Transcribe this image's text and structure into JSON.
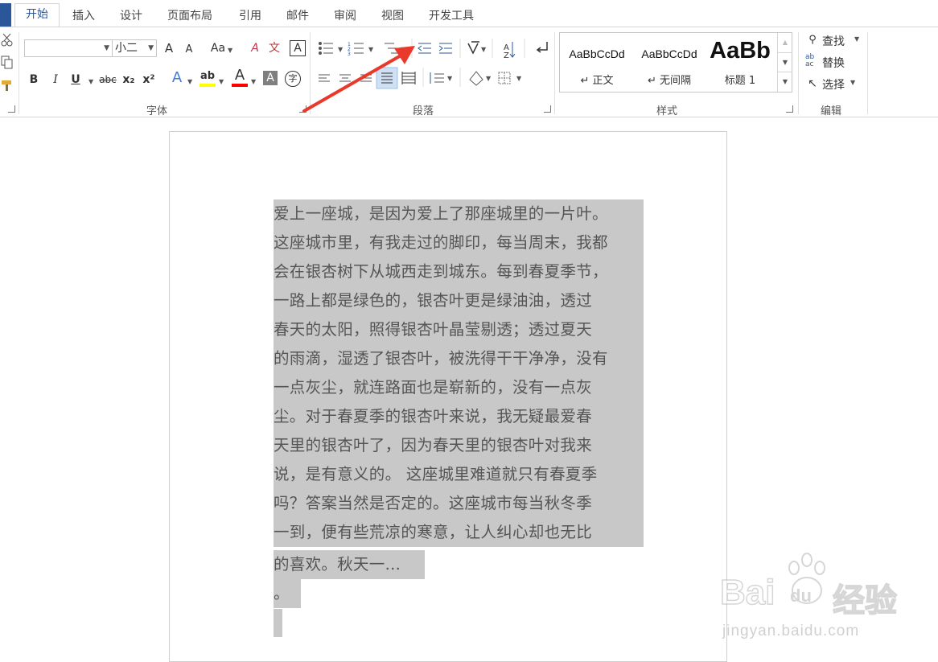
{
  "tabs": [
    "开始",
    "插入",
    "设计",
    "页面布局",
    "引用",
    "邮件",
    "审阅",
    "视图",
    "开发工具"
  ],
  "font": {
    "name_value": "",
    "size_value": "小二",
    "case_label": "Aa",
    "bold": "B",
    "italic": "I",
    "underline": "U",
    "strike": "abc",
    "subscript": "x₂",
    "superscript": "x²",
    "text_effect": "A",
    "highlight": "ab",
    "font_color": "A",
    "char_shading": "A",
    "enclose": "字",
    "grow": "A",
    "shrink": "A",
    "clear": "A",
    "phonetic": "文",
    "border": "A",
    "group_label": "字体"
  },
  "paragraph": {
    "group_label": "段落"
  },
  "styles": {
    "group_label": "样式",
    "items": [
      {
        "sample": "AaBbCcDd",
        "name": "↵ 正文"
      },
      {
        "sample": "AaBbCcDd",
        "name": "↵ 无间隔"
      },
      {
        "sample": "AaBb",
        "name": "标题 1"
      }
    ]
  },
  "editing": {
    "group_label": "编辑",
    "find": "查找",
    "replace": "替换",
    "select": "选择"
  },
  "document": {
    "lines": [
      "爱上一座城，是因为爱上了那座城里的一片叶。",
      "这座城市里，有我走过的脚印，每当周末，我都",
      "会在银杏树下从城西走到城东。每到春夏季节，",
      "一路上都是绿色的，银杏叶更是绿油油，透过",
      "春天的太阳，照得银杏叶晶莹剔透；透过夏天",
      "的雨滴，湿透了银杏叶，被洗得干干净净，没有",
      "一点灰尘，就连路面也是崭新的，没有一点灰",
      "尘。对于春夏季的银杏叶来说，我无疑最爱春",
      "天里的银杏叶了，因为春天里的银杏叶对我来",
      "说，是有意义的。 这座城里难道就只有春夏季",
      "吗？答案当然是否定的。这座城市每当秋冬季",
      "一到，便有些荒凉的寒意，让人纠心却也无比",
      "的喜欢。秋天一...",
      "。"
    ]
  },
  "watermark": {
    "brand": "Bai",
    "brand2": "du",
    "chinese": "经验",
    "url": "jingyan.baidu.com"
  },
  "colors": {
    "accent": "#2b579a",
    "selection": "#c8c8c8",
    "arrow": "#e8392b",
    "highlight_yellow": "#ffff00",
    "font_red": "#ff0000"
  }
}
